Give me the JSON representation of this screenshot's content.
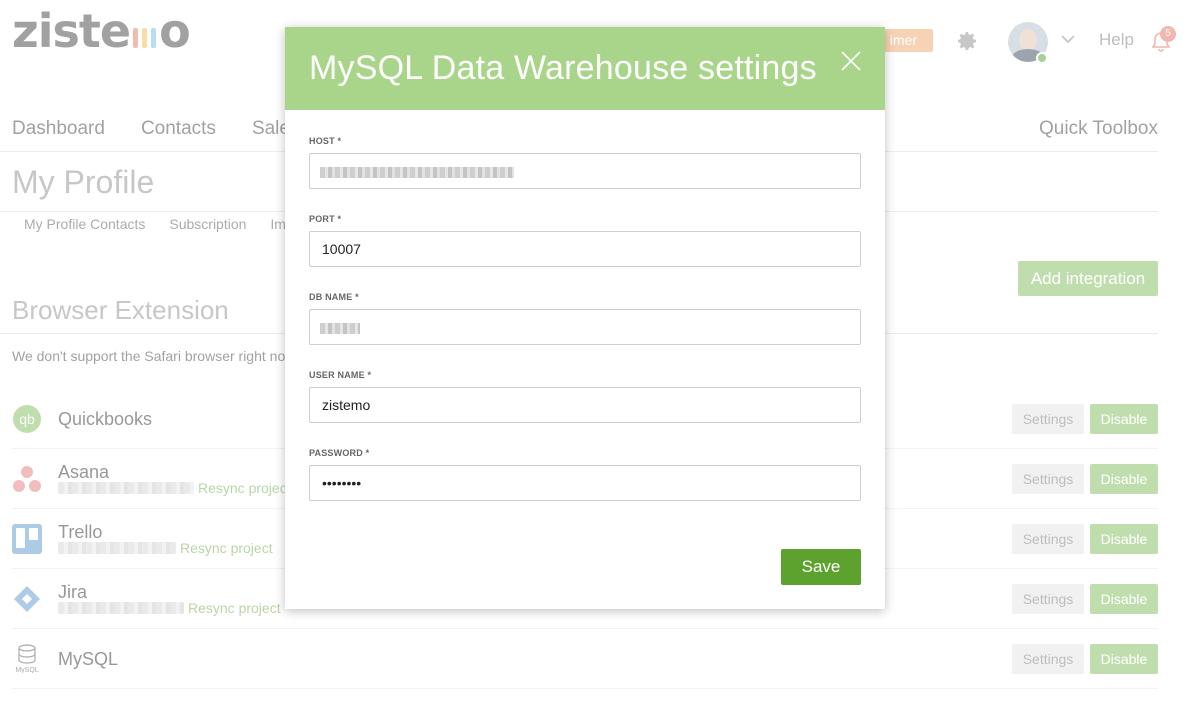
{
  "logo": {
    "text_left": "zist",
    "text_mid": "e",
    "text_right": "o",
    "bar_colors": [
      "#e6836e",
      "#f4c25a",
      "#7ec1e6",
      "#8ec66a"
    ]
  },
  "header": {
    "timer_label": "imer",
    "help": "Help",
    "notification_count": "5"
  },
  "nav": {
    "items": [
      "Dashboard",
      "Contacts",
      "Sale"
    ],
    "quick_toolbox": "Quick Toolbox"
  },
  "page": {
    "title": "My Profile",
    "subtabs": [
      "My Profile Contacts",
      "Subscription",
      "Imp"
    ],
    "add_integration": "Add integration",
    "section_title": "Browser Extension",
    "safari_note": "We don't support the Safari browser right nov"
  },
  "integrations": [
    {
      "name": "Quickbooks",
      "icon": "quickbooks-icon",
      "resync": "",
      "settings": "Settings",
      "disable": "Disable"
    },
    {
      "name": "Asana",
      "icon": "asana-icon",
      "resync": "Resync project",
      "settings": "Settings",
      "disable": "Disable"
    },
    {
      "name": "Trello",
      "icon": "trello-icon",
      "resync": "Resync project",
      "settings": "Settings",
      "disable": "Disable"
    },
    {
      "name": "Jira",
      "icon": "jira-icon",
      "resync": "Resync project",
      "settings": "Settings",
      "disable": "Disable"
    },
    {
      "name": "MySQL",
      "icon": "mysql-icon",
      "resync": "",
      "settings": "Settings",
      "disable": "Disable"
    }
  ],
  "modal": {
    "title": "MySQL Data Warehouse settings",
    "fields": {
      "host": {
        "label": "HOST *",
        "value": ""
      },
      "port": {
        "label": "PORT *",
        "value": "10007"
      },
      "db_name": {
        "label": "DB NAME *",
        "value": ""
      },
      "user_name": {
        "label": "USER NAME *",
        "value": "zistemo"
      },
      "password": {
        "label": "PASSWORD *",
        "value": "••••••••"
      }
    },
    "save": "Save"
  },
  "colors": {
    "header_green": "#a9d58a",
    "save_green": "#5da22e",
    "disable_green": "#8dc46b",
    "resync_green": "#7fb35b"
  }
}
